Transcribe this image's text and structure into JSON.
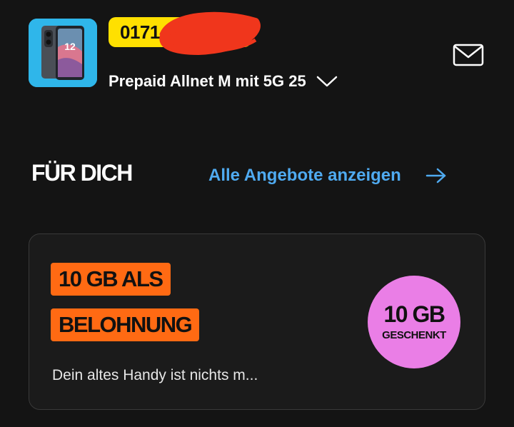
{
  "header": {
    "phone_number_visible": "0171",
    "tariff_name": "Prepaid Allnet M mit 5G 25"
  },
  "icons": {
    "device_thumbnail": "smartphone-image",
    "tariff_dropdown": "chevron-down-icon",
    "messages": "mail-icon",
    "all_offers_arrow": "arrow-right-icon"
  },
  "section": {
    "title": "FÜR DICH",
    "link_label": "Alle Angebote anzeigen"
  },
  "offer": {
    "tag_line_1": "10 GB ALS",
    "tag_line_2": "BELOHNUNG",
    "badge_amount": "10 GB",
    "badge_text": "GESCHENKT",
    "description": "Dein altes Handy ist nichts m..."
  },
  "colors": {
    "background": "#141414",
    "card_background": "#1b1b1b",
    "phone_badge": "#ffe000",
    "link_blue": "#4faaf0",
    "promo_orange": "#ff6a13",
    "gift_pink": "#ea7ee6",
    "redaction_red": "#f0361c"
  }
}
